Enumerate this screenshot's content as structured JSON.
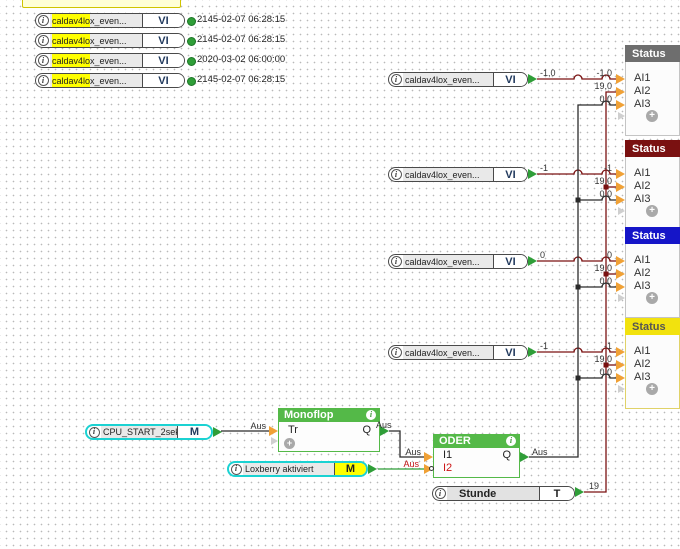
{
  "left_terminals": [
    {
      "label_highlight": "caldav4lo",
      "label_rest": "x_even...",
      "port": "VI",
      "value": "2145-02-07 06:28:15"
    },
    {
      "label_highlight": "caldav4lo",
      "label_rest": "x_even...",
      "port": "VI",
      "value": "2145-02-07 06:28:15"
    },
    {
      "label_highlight": "caldav4lo",
      "label_rest": "x_even...",
      "port": "VI",
      "value": "2020-03-02 06:00:00"
    },
    {
      "label_highlight": "caldav4lo",
      "label_rest": "x_even...",
      "port": "VI",
      "value": "2145-02-07 06:28:15"
    }
  ],
  "mid_terminals": [
    {
      "label": "caldav4lox_even...",
      "port": "VI",
      "output_value": "-1,0"
    },
    {
      "label": "caldav4lox_even...",
      "port": "VI",
      "output_value": "-1"
    },
    {
      "label": "caldav4lox_even...",
      "port": "VI",
      "output_value": "0"
    },
    {
      "label": "caldav4lox_even...",
      "port": "VI",
      "output_value": "-1"
    }
  ],
  "status_blocks": [
    {
      "title": "Status",
      "header_color": "#6e6e6e",
      "title_color": "#ffffff",
      "inputs": [
        {
          "name": "AI1",
          "value": "-1,0"
        },
        {
          "name": "AI2",
          "value": "19,0"
        },
        {
          "name": "AI3",
          "value": "0,0"
        }
      ]
    },
    {
      "title": "Status",
      "header_color": "#7a1111",
      "title_color": "#ffffff",
      "inputs": [
        {
          "name": "AI1",
          "value": "-1"
        },
        {
          "name": "AI2",
          "value": "19,0"
        },
        {
          "name": "AI3",
          "value": "0,0"
        }
      ]
    },
    {
      "title": "Status",
      "header_color": "#1515c8",
      "title_color": "#ffffff",
      "inputs": [
        {
          "name": "AI1",
          "value": "0"
        },
        {
          "name": "AI2",
          "value": "19,0"
        },
        {
          "name": "AI3",
          "value": "0,0"
        }
      ]
    },
    {
      "title": "Status",
      "header_color": "#f2e20e",
      "title_color": "#555555",
      "inputs": [
        {
          "name": "AI1",
          "value": "-1"
        },
        {
          "name": "AI2",
          "value": "19,0"
        },
        {
          "name": "AI3",
          "value": "0,0"
        }
      ]
    }
  ],
  "function_blocks": {
    "monoflop": {
      "title": "Monoflop",
      "input": "Tr",
      "output": "Q",
      "output_label": "Aus"
    },
    "oder": {
      "title": "ODER",
      "input1": "I1",
      "input2": "I2",
      "output": "Q",
      "input1_label": "Aus",
      "input2_label": "Aus",
      "output_label": "Aus"
    }
  },
  "io_terminals": {
    "cpu": {
      "label": "CPU_START_2sek",
      "port": "M",
      "output_label": "Aus"
    },
    "loxberry": {
      "label": "Loxberry aktiviert",
      "port": "M"
    },
    "stunde": {
      "label": "Stunde",
      "port": "T",
      "output_value": "19"
    }
  },
  "icons": {
    "info": "i",
    "plus": "+"
  },
  "colors": {
    "block_green": "#54b948",
    "wire_red": "#7a1111",
    "wire_black": "#2b2b2b",
    "wire_green": "#2f9e38",
    "connector_orange": "#f0a136",
    "connector_green": "#2f9e38",
    "highlight_yellow": "#ffff00",
    "cyan_border": "#1bd2d2"
  }
}
